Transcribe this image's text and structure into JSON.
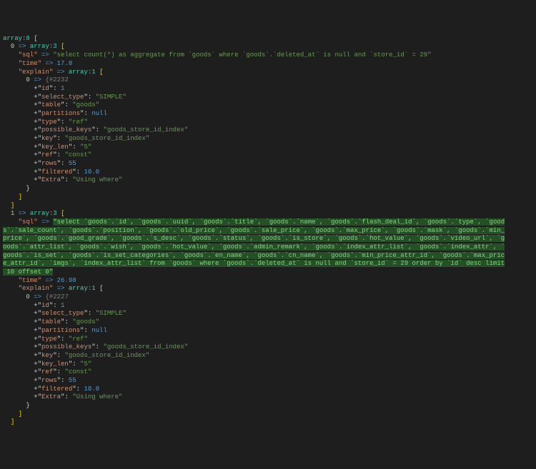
{
  "header": "array:8 [",
  "entries": [
    {
      "index": "0",
      "array_header": "array:3 [",
      "sql_label": "\"sql\"",
      "arrow": "=>",
      "sql": "\"select count(*) as aggregate from `goods` where `goods`.`deleted_at` is null and `store_id` = 29\"",
      "time_label": "\"time\"",
      "time_value": "17.8",
      "explain_label": "\"explain\"",
      "explain_header": "array:1 [",
      "explain_idx": "0",
      "explain_obj": "{#2232",
      "rows": [
        {
          "prefix": "+\"",
          "key": "id",
          "suffix": "\": ",
          "val": "1",
          "val_class": "c-num"
        },
        {
          "prefix": "+\"",
          "key": "select_type",
          "suffix": "\": ",
          "val": "\"SIMPLE\"",
          "val_class": "c-str"
        },
        {
          "prefix": "+\"",
          "key": "table",
          "suffix": "\": ",
          "val": "\"goods\"",
          "val_class": "c-str"
        },
        {
          "prefix": "+\"",
          "key": "partitions",
          "suffix": "\": ",
          "val": "null",
          "val_class": "c-null"
        },
        {
          "prefix": "+\"",
          "key": "type",
          "suffix": "\": ",
          "val": "\"ref\"",
          "val_class": "c-str"
        },
        {
          "prefix": "+\"",
          "key": "possible_keys",
          "suffix": "\": ",
          "val": "\"goods_store_id_index\"",
          "val_class": "c-str"
        },
        {
          "prefix": "+\"",
          "key": "key",
          "suffix": "\": ",
          "val": "\"goods_store_id_index\"",
          "val_class": "c-str"
        },
        {
          "prefix": "+\"",
          "key": "key_len",
          "suffix": "\": ",
          "val": "\"5\"",
          "val_class": "c-str"
        },
        {
          "prefix": "+\"",
          "key": "ref",
          "suffix": "\": ",
          "val": "\"const\"",
          "val_class": "c-str"
        },
        {
          "prefix": "+\"",
          "key": "rows",
          "suffix": "\": ",
          "val": "55",
          "val_class": "c-num"
        },
        {
          "prefix": "+\"",
          "key": "filtered",
          "suffix": "\": ",
          "val": "10.0",
          "val_class": "c-num"
        },
        {
          "prefix": "+\"",
          "key": "Extra",
          "suffix": "\": ",
          "val": "\"Using where\"",
          "val_class": "c-str"
        }
      ]
    },
    {
      "index": "1",
      "array_header": "array:3 [",
      "sql_label": "\"sql\"",
      "arrow": "=>",
      "sql_multiline": [
        "\"select `goods`.`id`, `goods`.`uuid`, `goods`.`title`, `goods`.`name`, `goods`.`flash_deal_id`, `goods`.`type`, `good",
        "s`.`sale_count`, `goods`.`position`, `goods`.`old_price`, `goods`.`sale_price`, `goods`.`max_price`, `goods`.`mask`, `goods`.`min_",
        "price`, `goods`.`good_grade`, `goods`.`s_desc`, `goods`.`status`, `goods`.`is_store`, `goods`.`hot_value`, `goods`.`video_url`, `g",
        "oods`.`attr_list`, `goods`.`wish`, `goods`.`hot_value`, `goods`.`admin_remark`, `goods`.`index_attr_list`, `goods`.`index_attr`, `",
        "goods`.`is_set`, `goods`.`is_set_categories`, `goods`.`en_name`, `goods`.`cn_name`, `goods`.`min_price_attr_id`, `goods`.`max_pric",
        "e_attr_id`, `imgs`, `index_attr_list` from `goods` where `goods`.`deleted_at` is null and `store_id` = 29 order by `id` desc limit",
        " 10 offset 0\""
      ],
      "time_label": "\"time\"",
      "time_value": "26.98",
      "explain_label": "\"explain\"",
      "explain_header": "array:1 [",
      "explain_idx": "0",
      "explain_obj": "{#2227",
      "rows": [
        {
          "prefix": "+\"",
          "key": "id",
          "suffix": "\": ",
          "val": "1",
          "val_class": "c-num"
        },
        {
          "prefix": "+\"",
          "key": "select_type",
          "suffix": "\": ",
          "val": "\"SIMPLE\"",
          "val_class": "c-str"
        },
        {
          "prefix": "+\"",
          "key": "table",
          "suffix": "\": ",
          "val": "\"goods\"",
          "val_class": "c-str"
        },
        {
          "prefix": "+\"",
          "key": "partitions",
          "suffix": "\": ",
          "val": "null",
          "val_class": "c-null"
        },
        {
          "prefix": "+\"",
          "key": "type",
          "suffix": "\": ",
          "val": "\"ref\"",
          "val_class": "c-str"
        },
        {
          "prefix": "+\"",
          "key": "possible_keys",
          "suffix": "\": ",
          "val": "\"goods_store_id_index\"",
          "val_class": "c-str"
        },
        {
          "prefix": "+\"",
          "key": "key",
          "suffix": "\": ",
          "val": "\"goods_store_id_index\"",
          "val_class": "c-str"
        },
        {
          "prefix": "+\"",
          "key": "key_len",
          "suffix": "\": ",
          "val": "\"5\"",
          "val_class": "c-str"
        },
        {
          "prefix": "+\"",
          "key": "ref",
          "suffix": "\": ",
          "val": "\"const\"",
          "val_class": "c-str"
        },
        {
          "prefix": "+\"",
          "key": "rows",
          "suffix": "\": ",
          "val": "55",
          "val_class": "c-num"
        },
        {
          "prefix": "+\"",
          "key": "filtered",
          "suffix": "\": ",
          "val": "10.0",
          "val_class": "c-num"
        },
        {
          "prefix": "+\"",
          "key": "Extra",
          "suffix": "\": ",
          "val": "\"Using where\"",
          "val_class": "c-str"
        }
      ]
    }
  ],
  "indent": {
    "l1": "  ",
    "l2": "    ",
    "l3": "      ",
    "l4": "        "
  }
}
